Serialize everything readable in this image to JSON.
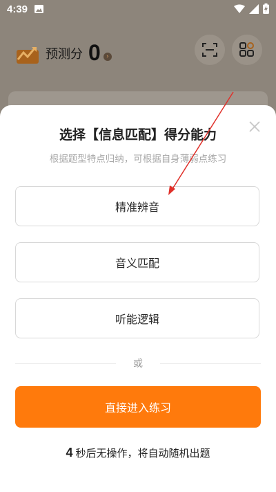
{
  "status_bar": {
    "time": "4:39"
  },
  "header": {
    "score_label": "预测分",
    "score_value": "0",
    "score_chevron": "›"
  },
  "sheet": {
    "title": "选择【信息匹配】得分能力",
    "subtitle": "根据题型特点归纳，可根据自身薄弱点练习",
    "options": [
      {
        "label": "精准辨音"
      },
      {
        "label": "音义匹配"
      },
      {
        "label": "听能逻辑"
      }
    ],
    "divider_text": "或",
    "primary_button": "直接进入练习",
    "countdown": {
      "number": "4",
      "text": "秒后无操作，将自动随机出题"
    }
  },
  "colors": {
    "accent": "#ff7a0c",
    "annotation_arrow": "#e0302a"
  }
}
